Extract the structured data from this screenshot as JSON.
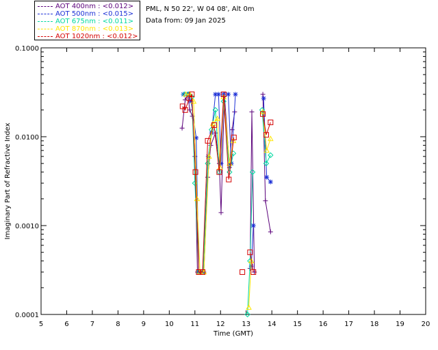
{
  "header": {
    "station_line": "PML, N 50 22', W 04 08', Alt 0m",
    "date_line": "Data from: 09 Jan 2025"
  },
  "legend": [
    {
      "label": "AOT  400nm : <0.012>",
      "color": "#5a007a"
    },
    {
      "label": "AOT  500nm : <0.015>",
      "color": "#1a2ed6"
    },
    {
      "label": "AOT  675nm : <0.011>",
      "color": "#00d8a0"
    },
    {
      "label": "AOT  870nm : <0.013>",
      "color": "#ffe600"
    },
    {
      "label": "AOT 1020nm : <0.012>",
      "color": "#d40000"
    }
  ],
  "chart_data": {
    "type": "line",
    "xlabel": "Time (GMT)",
    "ylabel": "Imaginary Part of Refractive Index",
    "xlim": [
      5,
      20
    ],
    "ylim": [
      0.0001,
      0.1
    ],
    "yscale": "log",
    "xticks": [
      "5",
      "6",
      "7",
      "8",
      "9",
      "10",
      "11",
      "12",
      "13",
      "14",
      "15",
      "16",
      "17",
      "18",
      "19",
      "20"
    ],
    "yticks": [
      {
        "value": 0.1,
        "label": "0.1000"
      },
      {
        "value": 0.01,
        "label": "0.0100"
      },
      {
        "value": 0.001,
        "label": "0.0010"
      },
      {
        "value": 0.0001,
        "label": "0.0001"
      }
    ],
    "series": [
      {
        "name": "AOT  400nm",
        "color": "#5a007a",
        "marker": "plus",
        "segments": [
          [
            [
              10.5,
              0.0125
            ],
            [
              10.62,
              0.026
            ],
            [
              10.72,
              0.03
            ],
            [
              10.8,
              0.02
            ],
            [
              10.9,
              0.017
            ],
            [
              11.0,
              0.006
            ],
            [
              11.1,
              0.0003
            ],
            [
              11.2,
              0.0003
            ],
            [
              11.35,
              0.0003
            ],
            [
              11.5,
              0.0035
            ],
            [
              11.62,
              0.008
            ],
            [
              11.8,
              0.011
            ],
            [
              11.95,
              0.005
            ],
            [
              12.02,
              0.0014
            ],
            [
              12.15,
              0.03
            ],
            [
              12.35,
              0.0045
            ],
            [
              12.45,
              0.012
            ],
            [
              12.55,
              0.019
            ]
          ],
          [
            [
              13.15,
              0.00033
            ],
            [
              13.22,
              0.019
            ],
            [
              13.32,
              0.0003
            ]
          ],
          [
            [
              13.65,
              0.03
            ],
            [
              13.75,
              0.0019
            ],
            [
              13.95,
              0.00085
            ]
          ]
        ]
      },
      {
        "name": "AOT  500nm",
        "color": "#1a2ed6",
        "marker": "star",
        "segments": [
          [
            [
              10.55,
              0.03
            ],
            [
              10.7,
              0.03
            ],
            [
              10.85,
              0.025
            ],
            [
              11.05,
              0.0097
            ],
            [
              11.15,
              0.0003
            ],
            [
              11.3,
              0.0003
            ],
            [
              11.52,
              0.006
            ],
            [
              11.65,
              0.011
            ],
            [
              11.8,
              0.03
            ],
            [
              11.92,
              0.03
            ],
            [
              12.02,
              0.005
            ],
            [
              12.12,
              0.03
            ],
            [
              12.3,
              0.03
            ],
            [
              12.42,
              0.005
            ],
            [
              12.58,
              0.03
            ]
          ],
          [
            [
              13.2,
              0.00035
            ],
            [
              13.28,
              0.001
            ]
          ],
          [
            [
              13.68,
              0.027
            ],
            [
              13.8,
              0.0035
            ],
            [
              13.95,
              0.0031
            ]
          ]
        ]
      },
      {
        "name": "AOT  675nm",
        "color": "#00d8a0",
        "marker": "diamond",
        "segments": [
          [
            [
              10.6,
              0.03
            ],
            [
              10.75,
              0.03
            ],
            [
              10.88,
              0.028
            ],
            [
              11.0,
              0.003
            ],
            [
              11.15,
              0.0003
            ],
            [
              11.32,
              0.0003
            ],
            [
              11.5,
              0.005
            ],
            [
              11.65,
              0.012
            ],
            [
              11.8,
              0.02
            ],
            [
              11.95,
              0.004
            ],
            [
              12.12,
              0.025
            ],
            [
              12.35,
              0.004
            ],
            [
              12.5,
              0.0065
            ]
          ],
          [
            [
              13.05,
              0.0001
            ],
            [
              13.15,
              0.0004
            ],
            [
              13.25,
              0.004
            ]
          ],
          [
            [
              13.62,
              0.02
            ],
            [
              13.78,
              0.005
            ],
            [
              13.95,
              0.0062
            ]
          ]
        ]
      },
      {
        "name": "AOT  870nm",
        "color": "#ffe600",
        "marker": "triangle",
        "segments": [
          [
            [
              10.65,
              0.03
            ],
            [
              10.8,
              0.03
            ],
            [
              10.95,
              0.025
            ],
            [
              11.08,
              0.002
            ],
            [
              11.2,
              0.0003
            ],
            [
              11.35,
              0.0003
            ],
            [
              11.55,
              0.006
            ],
            [
              11.7,
              0.014
            ],
            [
              11.88,
              0.016
            ],
            [
              11.98,
              0.0045
            ],
            [
              12.12,
              0.028
            ],
            [
              12.35,
              0.005
            ],
            [
              12.5,
              0.009
            ]
          ],
          [
            [
              13.1,
              0.00012
            ],
            [
              13.2,
              0.0004
            ]
          ],
          [
            [
              13.65,
              0.019
            ],
            [
              13.8,
              0.007
            ],
            [
              13.95,
              0.0095
            ]
          ]
        ]
      },
      {
        "name": "AOT 1020nm",
        "color": "#d40000",
        "marker": "square",
        "segments": [
          [
            [
              10.52,
              0.022
            ],
            [
              10.62,
              0.02
            ],
            [
              10.78,
              0.027
            ],
            [
              10.88,
              0.03
            ],
            [
              11.02,
              0.004
            ],
            [
              11.15,
              0.0003
            ],
            [
              11.3,
              0.0003
            ],
            [
              11.5,
              0.009
            ],
            [
              11.75,
              0.0135
            ],
            [
              11.95,
              0.004
            ],
            [
              12.12,
              0.03
            ],
            [
              12.32,
              0.0033
            ],
            [
              12.52,
              0.0098
            ]
          ],
          [
            [
              12.85,
              0.0003
            ]
          ],
          [
            [
              13.15,
              0.0005
            ],
            [
              13.28,
              0.0003
            ]
          ],
          [
            [
              13.65,
              0.018
            ],
            [
              13.78,
              0.0105
            ],
            [
              13.95,
              0.0145
            ]
          ]
        ]
      }
    ]
  }
}
